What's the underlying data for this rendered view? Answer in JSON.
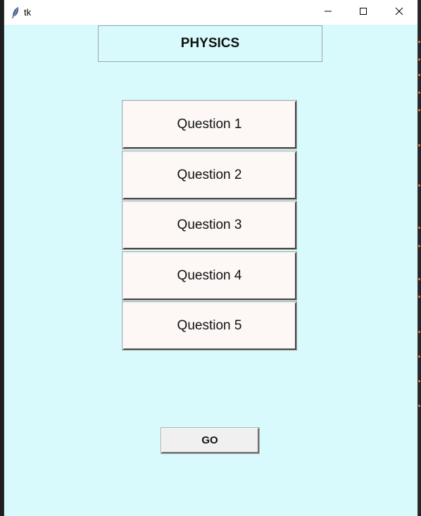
{
  "window": {
    "title": "tk"
  },
  "header": {
    "title": "PHYSICS"
  },
  "questions": [
    {
      "label": "Question 1"
    },
    {
      "label": "Question 2"
    },
    {
      "label": "Question 3"
    },
    {
      "label": "Question 4"
    },
    {
      "label": "Question 5"
    }
  ],
  "actions": {
    "go_label": "GO"
  },
  "colors": {
    "window_bg": "#d9fafc",
    "button_bg": "#fdf8f6",
    "go_button_bg": "#f0f0f0"
  },
  "icons": {
    "app": "feather-icon",
    "minimize": "minimize-icon",
    "maximize": "maximize-icon",
    "close": "close-icon"
  }
}
